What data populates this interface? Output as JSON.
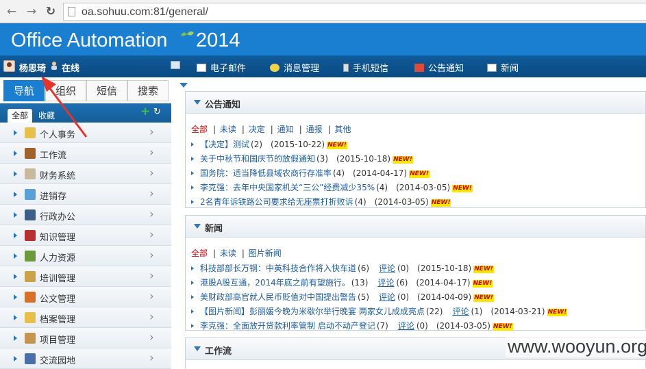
{
  "browser": {
    "url": "oa.sohuu.com:81/general/"
  },
  "header": {
    "title": "Office Automation",
    "year": "2014"
  },
  "user": {
    "name": "杨思琦",
    "status": "在线"
  },
  "top_nav": [
    {
      "label": "电子邮件",
      "icon": "mail-icon"
    },
    {
      "label": "消息管理",
      "icon": "message-icon"
    },
    {
      "label": "手机短信",
      "icon": "phone-icon"
    },
    {
      "label": "公告通知",
      "icon": "megaphone-icon"
    },
    {
      "label": "新闻",
      "icon": "news-icon"
    }
  ],
  "side_tabs": [
    "导航",
    "组织",
    "短信",
    "搜索"
  ],
  "side_sub": {
    "all": "全部",
    "fav": "收藏"
  },
  "menu": [
    {
      "label": "个人事务",
      "icon": "calendar-icon",
      "color": "#e6c04a"
    },
    {
      "label": "工作流",
      "icon": "briefcase-icon",
      "color": "#a0622a"
    },
    {
      "label": "财务系统",
      "icon": "money-icon",
      "color": "#c7b99a"
    },
    {
      "label": "进销存",
      "icon": "inventory-icon",
      "color": "#5aa0d8"
    },
    {
      "label": "行政办公",
      "icon": "person-icon",
      "color": "#3c5f8a"
    },
    {
      "label": "知识管理",
      "icon": "book-icon",
      "color": "#b83030"
    },
    {
      "label": "人力资源",
      "icon": "people-icon",
      "color": "#6a9a3a"
    },
    {
      "label": "培训管理",
      "icon": "ruler-icon",
      "color": "#c9a24a"
    },
    {
      "label": "公文管理",
      "icon": "document-icon",
      "color": "#d9702a"
    },
    {
      "label": "档案管理",
      "icon": "folder-icon",
      "color": "#e6c04a"
    },
    {
      "label": "项目管理",
      "icon": "project-icon",
      "color": "#c79450"
    },
    {
      "label": "交流园地",
      "icon": "chat-icon",
      "color": "#4a6fa8"
    }
  ],
  "panels": {
    "notices": {
      "title": "公告通知",
      "filters": [
        "全部",
        "未读",
        "决定",
        "通知",
        "通报",
        "其他"
      ],
      "items": [
        {
          "title": "【决定】测试",
          "count": "(2)",
          "date": "(2015-10-22)"
        },
        {
          "title": "关于中秋节和国庆节的放假通知",
          "count": "(3)",
          "date": "(2015-10-18)"
        },
        {
          "title": "国务院：适当降低县域农商行存准率",
          "count": "(4)",
          "date": "(2014-04-17)"
        },
        {
          "title": "李克强：去年中央国家机关“三公”经费减少35%",
          "count": "(4)",
          "date": "(2014-03-05)"
        },
        {
          "title": "2名青年诉铁路公司要求给无座票打折败诉",
          "count": "(4)",
          "date": "(2014-03-05)"
        }
      ]
    },
    "news": {
      "title": "新闻",
      "filters": [
        "全部",
        "未读",
        "图片新闻"
      ],
      "items": [
        {
          "title": "科技部部长万钢：中英科技合作将入快车道",
          "count": "(6)",
          "comment": "评论",
          "comment_count": "(0)",
          "date": "(2015-10-18)"
        },
        {
          "title": "港股A股互通，2014年底之前有望施行。",
          "count": "(13)",
          "comment": "评论",
          "comment_count": "(6)",
          "date": "(2014-04-17)"
        },
        {
          "title": "美财政部高官就人民币贬值对中国提出警告",
          "count": "(5)",
          "comment": "评论",
          "comment_count": "(0)",
          "date": "(2014-04-09)"
        },
        {
          "title": "【图片新闻】彭丽媛今晚为米歇尔举行晚宴 两家女儿成成亮点",
          "count": "(22)",
          "comment": "评论",
          "comment_count": "(1)",
          "date": "(2014-03-21)"
        },
        {
          "title": "李克强：全面放开贷款利率管制 启动不动产登记",
          "count": "(7)",
          "comment": "评论",
          "comment_count": "(0)",
          "date": "(2014-03-05)"
        }
      ]
    },
    "workflow": {
      "title": "工作流"
    }
  },
  "new_badge": "NEW!",
  "watermark": "www.wooyun.org"
}
